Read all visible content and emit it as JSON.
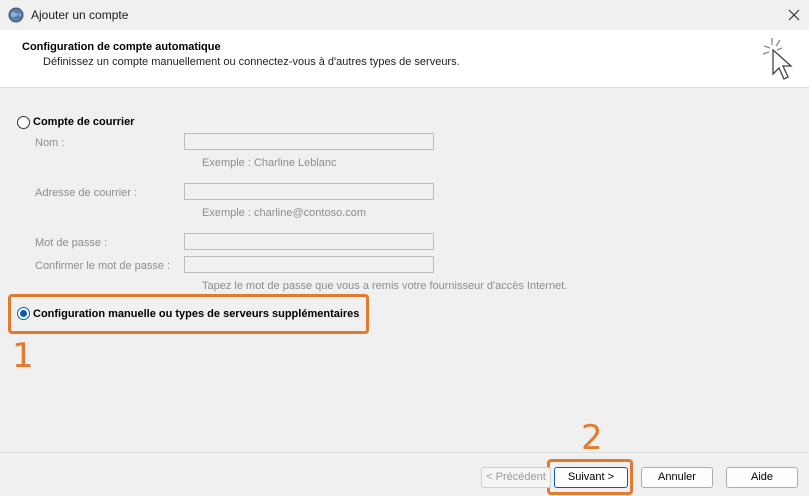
{
  "window": {
    "title": "Ajouter un compte",
    "close_icon": "close-icon",
    "app_icon": "outlook-globe-icon"
  },
  "header": {
    "title": "Configuration de compte automatique",
    "subtitle": "Définissez un compte manuellement ou connectez-vous à d'autres types de serveurs."
  },
  "email_account": {
    "label": "Compte de courrier",
    "selected": false,
    "name_label": "Nom :",
    "name_value": "",
    "name_hint": "Exemple : Charline Leblanc",
    "email_label": "Adresse de courrier :",
    "email_value": "",
    "email_hint": "Exemple : charline@contoso.com",
    "password_label": "Mot de passe :",
    "confirm_label": "Confirmer le mot de passe :",
    "password_hint": "Tapez le mot de passe que vous a remis votre fournisseur d'accès Internet."
  },
  "manual_config": {
    "label": "Configuration manuelle ou types de serveurs supplémentaires",
    "selected": true
  },
  "annotations": {
    "step1": "1",
    "step2": "2",
    "color": "#e37b2e"
  },
  "buttons": {
    "previous": "< Précédent",
    "next": "Suivant >",
    "cancel": "Annuler",
    "help": "Aide"
  }
}
